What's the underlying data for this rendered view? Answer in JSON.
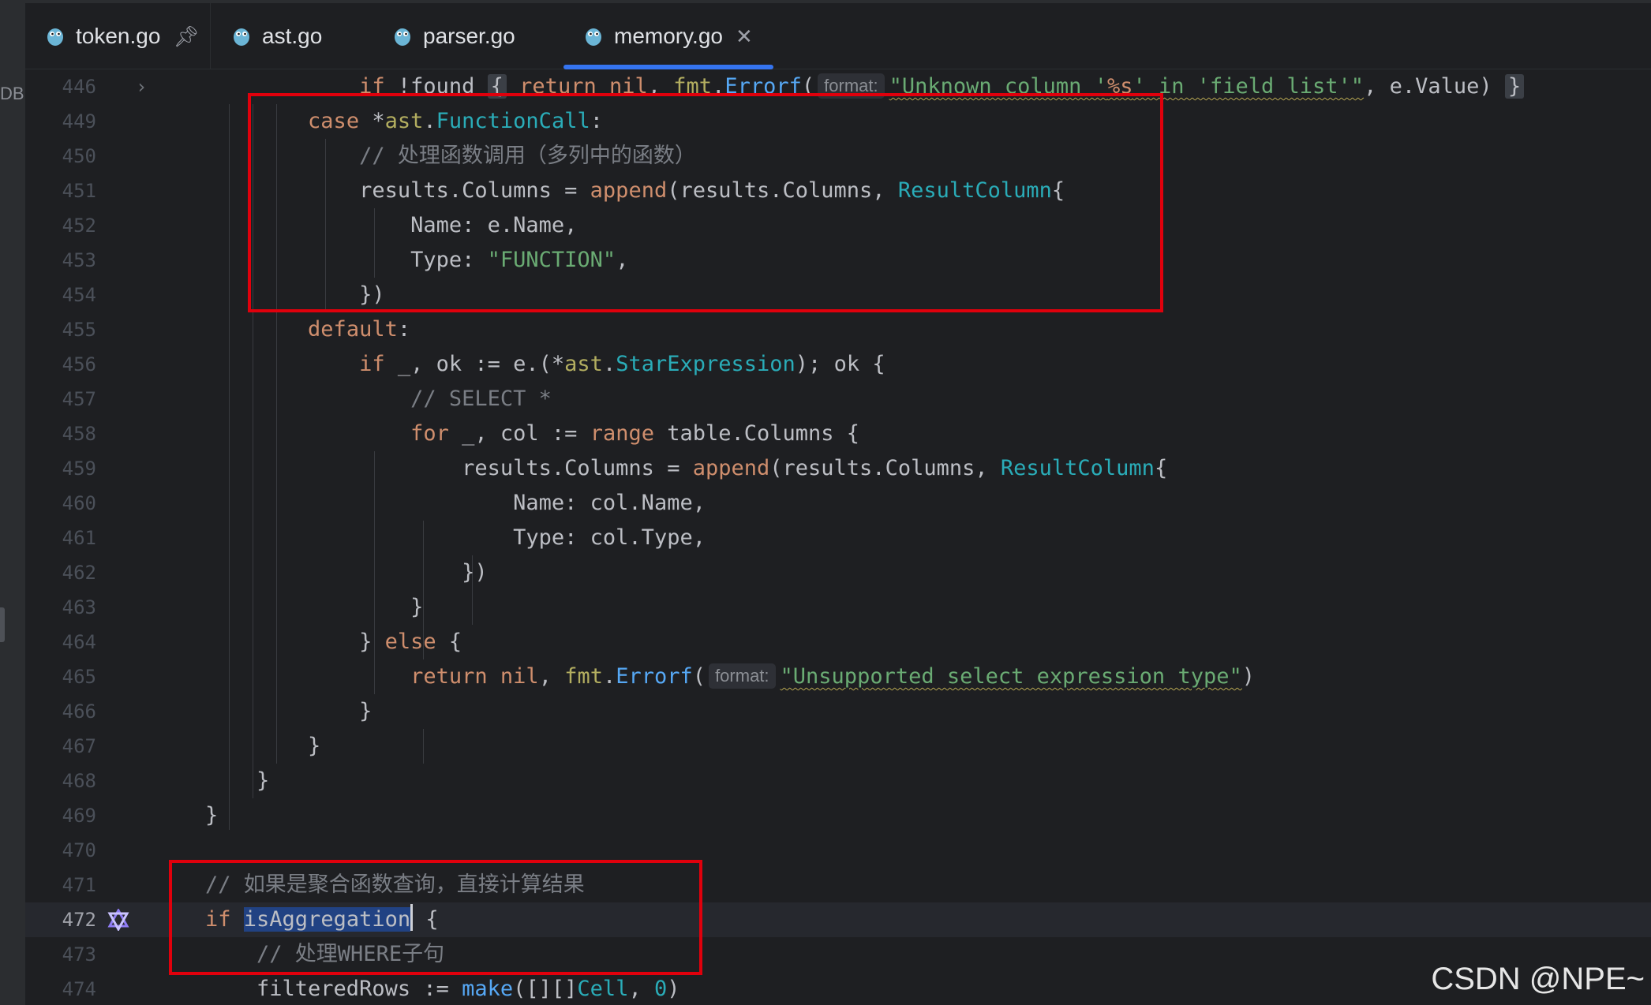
{
  "tabs": [
    {
      "label": "token.go",
      "pinned": true
    },
    {
      "label": "ast.go"
    },
    {
      "label": "parser.go"
    },
    {
      "label": "memory.go",
      "active": true
    }
  ],
  "gutter_label": "DB",
  "lines": [
    {
      "n": "446",
      "t": [
        {
          "s": "            "
        },
        {
          "s": "if",
          "c": "kw"
        },
        {
          "s": " !found "
        },
        {
          "s": "{",
          "c": "brace-hl"
        },
        {
          "s": " "
        },
        {
          "s": "return",
          "c": "kw"
        },
        {
          "s": " "
        },
        {
          "s": "nil",
          "c": "kw"
        },
        {
          "s": ", "
        },
        {
          "s": "fmt",
          "c": "pkg"
        },
        {
          "s": "."
        },
        {
          "s": "Errorf",
          "c": "fn"
        },
        {
          "s": "("
        },
        {
          "s": "format:",
          "c": "hint"
        },
        {
          "s": "\"Unknown column '",
          "c": "str wavy"
        },
        {
          "s": "%s",
          "c": "kw wavy"
        },
        {
          "s": "' in 'field list'\"",
          "c": "str wavy"
        },
        {
          "s": ", e.Value) "
        },
        {
          "s": "}",
          "c": "brace-hl"
        }
      ]
    },
    {
      "n": "449",
      "t": [
        {
          "s": "        "
        },
        {
          "s": "case",
          "c": "kw"
        },
        {
          "s": " *"
        },
        {
          "s": "ast",
          "c": "pkg"
        },
        {
          "s": "."
        },
        {
          "s": "FunctionCall",
          "c": "ty"
        },
        {
          "s": ":"
        }
      ]
    },
    {
      "n": "450",
      "t": [
        {
          "s": "            "
        },
        {
          "s": "// 处理函数调用（多列中的函数）",
          "c": "cmt"
        }
      ]
    },
    {
      "n": "451",
      "t": [
        {
          "s": "            results.Columns = "
        },
        {
          "s": "append",
          "c": "kw"
        },
        {
          "s": "(results.Columns, "
        },
        {
          "s": "ResultColumn",
          "c": "ty"
        },
        {
          "s": "{"
        }
      ]
    },
    {
      "n": "452",
      "t": [
        {
          "s": "                Name: e.Name,"
        }
      ]
    },
    {
      "n": "453",
      "t": [
        {
          "s": "                Type: "
        },
        {
          "s": "\"FUNCTION\"",
          "c": "str"
        },
        {
          "s": ","
        }
      ]
    },
    {
      "n": "454",
      "t": [
        {
          "s": "            })"
        }
      ]
    },
    {
      "n": "455",
      "t": [
        {
          "s": "        "
        },
        {
          "s": "default",
          "c": "kw"
        },
        {
          "s": ":"
        }
      ]
    },
    {
      "n": "456",
      "t": [
        {
          "s": "            "
        },
        {
          "s": "if",
          "c": "kw"
        },
        {
          "s": " _, ok := e.(*"
        },
        {
          "s": "ast",
          "c": "pkg"
        },
        {
          "s": "."
        },
        {
          "s": "StarExpression",
          "c": "ty"
        },
        {
          "s": "); ok {"
        }
      ]
    },
    {
      "n": "457",
      "t": [
        {
          "s": "                "
        },
        {
          "s": "// SELECT *",
          "c": "cmt"
        }
      ]
    },
    {
      "n": "458",
      "t": [
        {
          "s": "                "
        },
        {
          "s": "for",
          "c": "kw"
        },
        {
          "s": " _, col := "
        },
        {
          "s": "range",
          "c": "kw"
        },
        {
          "s": " table.Columns {"
        }
      ]
    },
    {
      "n": "459",
      "t": [
        {
          "s": "                    results.Columns = "
        },
        {
          "s": "append",
          "c": "kw"
        },
        {
          "s": "(results.Columns, "
        },
        {
          "s": "ResultColumn",
          "c": "ty"
        },
        {
          "s": "{"
        }
      ]
    },
    {
      "n": "460",
      "t": [
        {
          "s": "                        Name: col.Name,"
        }
      ]
    },
    {
      "n": "461",
      "t": [
        {
          "s": "                        Type: col.Type,"
        }
      ]
    },
    {
      "n": "462",
      "t": [
        {
          "s": "                    })"
        }
      ]
    },
    {
      "n": "463",
      "t": [
        {
          "s": "                }"
        }
      ]
    },
    {
      "n": "464",
      "t": [
        {
          "s": "            } "
        },
        {
          "s": "else",
          "c": "kw"
        },
        {
          "s": " {"
        }
      ]
    },
    {
      "n": "465",
      "t": [
        {
          "s": "                "
        },
        {
          "s": "return",
          "c": "kw"
        },
        {
          "s": " "
        },
        {
          "s": "nil",
          "c": "kw"
        },
        {
          "s": ", "
        },
        {
          "s": "fmt",
          "c": "pkg"
        },
        {
          "s": "."
        },
        {
          "s": "Errorf",
          "c": "fn"
        },
        {
          "s": "("
        },
        {
          "s": "format:",
          "c": "hint"
        },
        {
          "s": "\"Unsupported select expression type\"",
          "c": "str wavy"
        },
        {
          "s": ")"
        }
      ]
    },
    {
      "n": "466",
      "t": [
        {
          "s": "            }"
        }
      ]
    },
    {
      "n": "467",
      "t": [
        {
          "s": "        }"
        }
      ]
    },
    {
      "n": "468",
      "t": [
        {
          "s": "    }"
        }
      ]
    },
    {
      "n": "469",
      "t": [
        {
          "s": "}"
        }
      ]
    },
    {
      "n": "470",
      "t": []
    },
    {
      "n": "471",
      "t": [
        {
          "s": "// 如果是聚合函数查询，直接计算结果",
          "c": "cmt"
        }
      ]
    },
    {
      "n": "472",
      "current": true,
      "t": [
        {
          "s": "if",
          "c": "kw"
        },
        {
          "s": " "
        },
        {
          "s": "isAggregation",
          "c": "sel"
        },
        {
          "s": "",
          "c": "caret"
        },
        {
          "s": " {"
        }
      ]
    },
    {
      "n": "473",
      "t": [
        {
          "s": "    "
        },
        {
          "s": "// 处理WHERE子句",
          "c": "cmt"
        }
      ]
    },
    {
      "n": "474",
      "t": [
        {
          "s": "    filteredRows := "
        },
        {
          "s": "make",
          "c": "fn"
        },
        {
          "s": "([][]"
        },
        {
          "s": "Cell",
          "c": "ty"
        },
        {
          "s": ", "
        },
        {
          "s": "0",
          "c": "num-lit"
        },
        {
          "s": ")"
        }
      ]
    }
  ],
  "watermark": "CSDN @NPE~"
}
